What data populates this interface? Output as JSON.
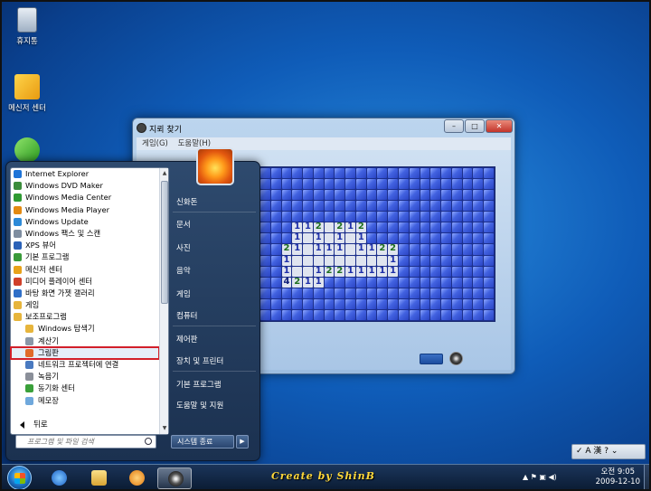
{
  "desktop": {
    "icons": [
      {
        "label": "휴지통",
        "icon": "recycle-bin-icon"
      },
      {
        "label": "메신저 센터",
        "icon": "messenger-icon"
      },
      {
        "label": "",
        "icon": "sync-center-icon"
      }
    ]
  },
  "minesweeper": {
    "title": "지뢰 찾기",
    "menu": [
      "게임(G)",
      "도움말(H)"
    ],
    "buttons": {
      "minimize": "–",
      "maximize": "□",
      "close": "✕"
    },
    "board": {
      "cols": 22,
      "rows": 14,
      "open_cells": [
        {
          "r": 5,
          "c": 3,
          "v": "1"
        },
        {
          "r": 5,
          "c": 4,
          "v": "1"
        },
        {
          "r": 5,
          "c": 5,
          "v": "2"
        },
        {
          "r": 5,
          "c": 6,
          "v": ""
        },
        {
          "r": 5,
          "c": 7,
          "v": "2"
        },
        {
          "r": 5,
          "c": 8,
          "v": "1"
        },
        {
          "r": 5,
          "c": 9,
          "v": "2"
        },
        {
          "r": 6,
          "c": 3,
          "v": "1"
        },
        {
          "r": 6,
          "c": 4,
          "v": ""
        },
        {
          "r": 6,
          "c": 5,
          "v": "1"
        },
        {
          "r": 6,
          "c": 6,
          "v": ""
        },
        {
          "r": 6,
          "c": 7,
          "v": "1"
        },
        {
          "r": 6,
          "c": 8,
          "v": ""
        },
        {
          "r": 6,
          "c": 9,
          "v": "1"
        },
        {
          "r": 7,
          "c": 2,
          "v": "2"
        },
        {
          "r": 7,
          "c": 3,
          "v": "1"
        },
        {
          "r": 7,
          "c": 4,
          "v": ""
        },
        {
          "r": 7,
          "c": 5,
          "v": "1"
        },
        {
          "r": 7,
          "c": 6,
          "v": "1"
        },
        {
          "r": 7,
          "c": 7,
          "v": "1"
        },
        {
          "r": 7,
          "c": 8,
          "v": ""
        },
        {
          "r": 7,
          "c": 9,
          "v": "1"
        },
        {
          "r": 7,
          "c": 10,
          "v": "1"
        },
        {
          "r": 7,
          "c": 11,
          "v": "2"
        },
        {
          "r": 7,
          "c": 12,
          "v": "2"
        },
        {
          "r": 8,
          "c": 2,
          "v": "1"
        },
        {
          "r": 8,
          "c": 3,
          "v": ""
        },
        {
          "r": 8,
          "c": 4,
          "v": ""
        },
        {
          "r": 8,
          "c": 5,
          "v": ""
        },
        {
          "r": 8,
          "c": 6,
          "v": ""
        },
        {
          "r": 8,
          "c": 7,
          "v": ""
        },
        {
          "r": 8,
          "c": 8,
          "v": ""
        },
        {
          "r": 8,
          "c": 9,
          "v": ""
        },
        {
          "r": 8,
          "c": 10,
          "v": ""
        },
        {
          "r": 8,
          "c": 11,
          "v": ""
        },
        {
          "r": 8,
          "c": 12,
          "v": "1"
        },
        {
          "r": 9,
          "c": 2,
          "v": "1"
        },
        {
          "r": 9,
          "c": 3,
          "v": ""
        },
        {
          "r": 9,
          "c": 4,
          "v": ""
        },
        {
          "r": 9,
          "c": 5,
          "v": "1"
        },
        {
          "r": 9,
          "c": 6,
          "v": "2"
        },
        {
          "r": 9,
          "c": 7,
          "v": "2"
        },
        {
          "r": 9,
          "c": 8,
          "v": "1"
        },
        {
          "r": 9,
          "c": 9,
          "v": "1"
        },
        {
          "r": 9,
          "c": 10,
          "v": "1"
        },
        {
          "r": 9,
          "c": 11,
          "v": "1"
        },
        {
          "r": 9,
          "c": 12,
          "v": "1"
        },
        {
          "r": 10,
          "c": 2,
          "v": "4"
        },
        {
          "r": 10,
          "c": 3,
          "v": "2"
        },
        {
          "r": 10,
          "c": 4,
          "v": "1"
        },
        {
          "r": 10,
          "c": 5,
          "v": "1"
        }
      ]
    }
  },
  "start_menu": {
    "programs": [
      {
        "label": "Internet Explorer",
        "icon": "ie-icon",
        "color": "#1e74d8"
      },
      {
        "label": "Windows DVD Maker",
        "icon": "dvd-maker-icon",
        "color": "#3b8c3b"
      },
      {
        "label": "Windows Media Center",
        "icon": "media-center-icon",
        "color": "#2f9a33"
      },
      {
        "label": "Windows Media Player",
        "icon": "media-player-icon",
        "color": "#e38a12"
      },
      {
        "label": "Windows Update",
        "icon": "windows-update-icon",
        "color": "#2d8ad8"
      },
      {
        "label": "Windows 팩스 및 스캔",
        "icon": "fax-scan-icon",
        "color": "#7f8ea0"
      },
      {
        "label": "XPS 뷰어",
        "icon": "xps-viewer-icon",
        "color": "#2b62b8"
      },
      {
        "label": "기본 프로그램",
        "icon": "default-programs-icon",
        "color": "#3a9a3a"
      },
      {
        "label": "메신저 센터",
        "icon": "messenger-center-icon",
        "color": "#e8a21a"
      },
      {
        "label": "미디어 플레이어 센터",
        "icon": "media-player-center-icon",
        "color": "#d0402a"
      },
      {
        "label": "바탕 화면 가젯 갤러리",
        "icon": "gadget-gallery-icon",
        "color": "#2f6fc8"
      },
      {
        "label": "게임",
        "icon": "games-folder-icon",
        "color": "#e7b53c"
      },
      {
        "label": "보조프로그램",
        "icon": "accessories-folder-icon",
        "color": "#e7b53c"
      },
      {
        "label": "Windows 탐색기",
        "icon": "explorer-icon",
        "color": "#e7b53c",
        "sub": true
      },
      {
        "label": "계산기",
        "icon": "calculator-icon",
        "color": "#8a97a8",
        "sub": true
      },
      {
        "label": "그림판",
        "icon": "paint-icon",
        "color": "#e06a2a",
        "sub": true,
        "selected": true
      },
      {
        "label": "네트워크 프로젝터에 연결",
        "icon": "network-projector-icon",
        "color": "#4a7ac0",
        "sub": true
      },
      {
        "label": "녹음기",
        "icon": "sound-recorder-icon",
        "color": "#8a8f99",
        "sub": true
      },
      {
        "label": "동기화 센터",
        "icon": "sync-center-icon",
        "color": "#3aa03a",
        "sub": true
      },
      {
        "label": "메모장",
        "icon": "notepad-icon",
        "color": "#6fa8dc",
        "sub": true
      }
    ],
    "back_label": "뒤로",
    "search_placeholder": "프로그램 및 파일 검색",
    "right_items": [
      "신화돈",
      "문서",
      "사진",
      "음악",
      "게임",
      "컴퓨터",
      "제어판",
      "장치 및 프린터",
      "기본 프로그램",
      "도움말 및 지원"
    ],
    "shutdown_label": "시스템 종료",
    "shutdown_arrow": "▶"
  },
  "taskbar": {
    "credit": "Create by ShinB",
    "clock_period": "오전 9:05",
    "clock_date": "2009-12-10",
    "tray": "▲ ⚑ ▣ ◀)",
    "language": "✓ A 漢 ? ⌄"
  }
}
